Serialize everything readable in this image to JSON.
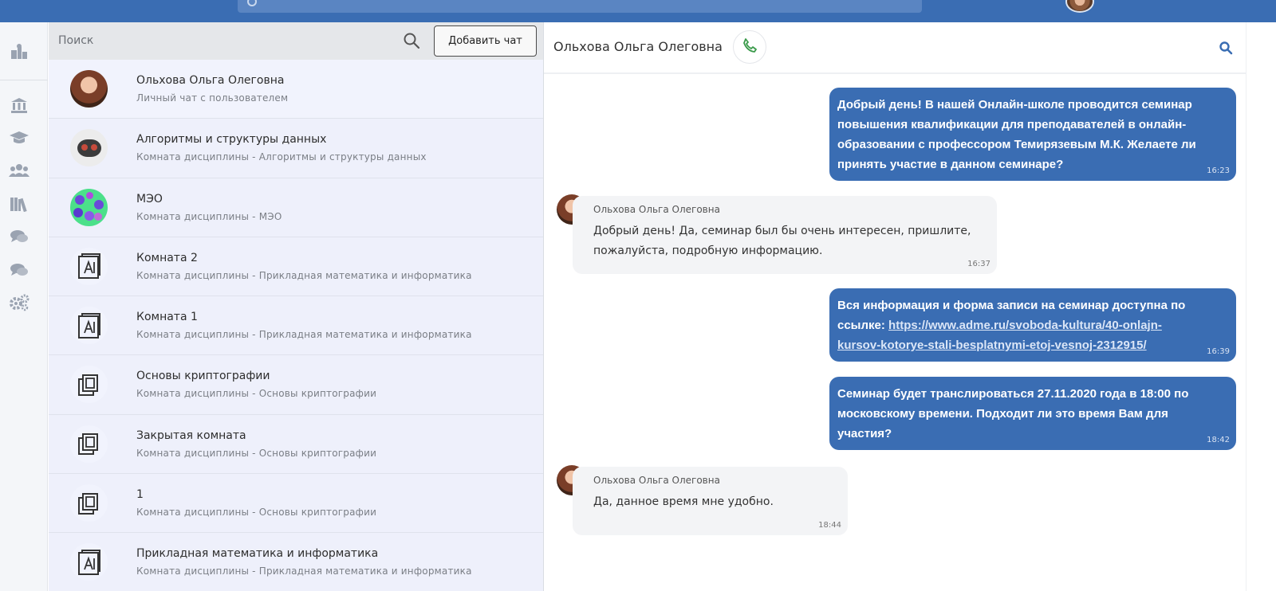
{
  "chatlist": {
    "search_placeholder": "Поиск",
    "add_chat_label": "Добавить чат",
    "rows": [
      {
        "title": "Ольхова Ольга Олеговна",
        "subtitle": "Личный чат с пользователем",
        "avatar": "user-photo"
      },
      {
        "title": "Алгоритмы и структуры данных",
        "subtitle": "Комната дисциплины - Алгоритмы и структуры данных",
        "avatar": "course-logo"
      },
      {
        "title": "МЭО",
        "subtitle": "Комната дисциплины - МЭО",
        "avatar": "dots-logo"
      },
      {
        "title": "Комната 2",
        "subtitle": "Комната дисциплины - Прикладная математика и информатика",
        "avatar": "drafting-room-icon"
      },
      {
        "title": "Комната 1",
        "subtitle": "Комната дисциплины - Прикладная математика и информатика",
        "avatar": "drafting-room-icon"
      },
      {
        "title": "Основы криптографии",
        "subtitle": "Комната дисциплины - Основы криптографии",
        "avatar": "stacked-frames-icon"
      },
      {
        "title": "Закрытая комната",
        "subtitle": "Комната дисциплины - Основы криптографии",
        "avatar": "stacked-frames-icon"
      },
      {
        "title": "1",
        "subtitle": "Комната дисциплины - Основы криптографии",
        "avatar": "stacked-frames-icon"
      },
      {
        "title": "Прикладная математика и информатика",
        "subtitle": "Комната дисциплины - Прикладная математика и информатика",
        "avatar": "drafting-room-icon"
      }
    ]
  },
  "conversation": {
    "title": "Ольхова Ольга Олеговна",
    "messages": [
      {
        "direction": "out",
        "text": "Добрый день! В нашей Онлайн-школе проводится семинар повышения квалификации для преподавателей в онлайн-образовании с профессором Темирязевым М.К. Желаете ли принять участие в данном семинаре?",
        "time": "16:23"
      },
      {
        "direction": "in",
        "sender": "Ольхова Ольга Олеговна",
        "text": "Добрый день! Да, семинар был бы очень интересен, пришлите, пожалуйста, подробную информацию.",
        "time": "16:37"
      },
      {
        "direction": "out",
        "text": "Вся информация и форма записи на семинар доступна по ссылке: ",
        "link": "https://www.adme.ru/svoboda-kultura/40-onlajn-kursov-kotorye-stali-besplatnymi-etoj-vesnoj-2312915/",
        "time": "16:39"
      },
      {
        "direction": "out",
        "text": "Семинар будет транслироваться 27.11.2020 года в 18:00 по московскому времени. Подходит ли это время Вам для участия?",
        "time": "18:42"
      },
      {
        "direction": "in",
        "sender": "Ольхова Ольга Олеговна",
        "text": "Да, данное время мне удобно.",
        "time": "18:44"
      }
    ]
  },
  "colors": {
    "brand": "#3a6db3",
    "call_icon": "#3a9a4a",
    "rail_icon": "#9aa3b1"
  },
  "rail_icons": [
    "dashboard-icon",
    "institution-icon",
    "graduation-cap-icon",
    "users-icon",
    "library-icon",
    "chat-bubbles-icon",
    "chat-bubbles-icon",
    "settings-gears-icon"
  ]
}
